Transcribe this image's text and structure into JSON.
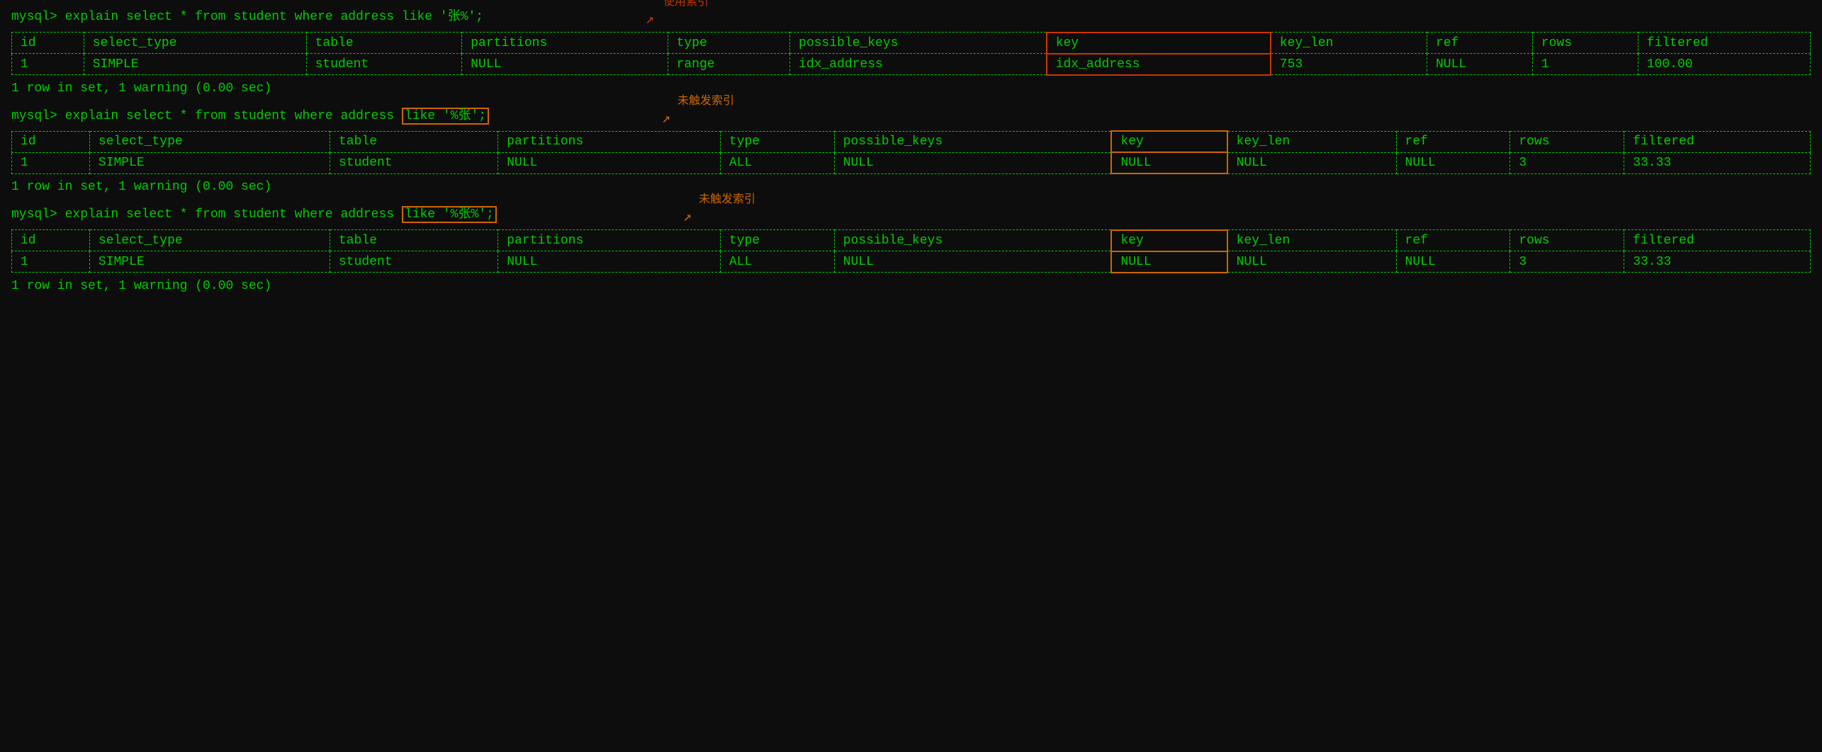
{
  "blocks": [
    {
      "id": "block1",
      "prompt": "mysql> explain select * from student where address like '张%';",
      "highlight": {
        "text": "key",
        "type": "red"
      },
      "annotation": {
        "text": "使用索引",
        "color": "red",
        "arrow": "↙"
      },
      "table": {
        "headers": [
          "id",
          "select_type",
          "table",
          "partitions",
          "type",
          "possible_keys",
          "key",
          "key_len",
          "ref",
          "rows",
          "filtered"
        ],
        "rows": [
          [
            "1",
            "SIMPLE",
            "student",
            "NULL",
            "range",
            "idx_address",
            "idx_address",
            "753",
            "NULL",
            "1",
            "100.00"
          ]
        ],
        "highlight_col": 6,
        "highlight_type": "red"
      },
      "result": "1 row in set, 1 warning (0.00 sec)"
    },
    {
      "id": "block2",
      "prompt_prefix": "mysql> explain select * from student where address ",
      "prompt_highlight": "like '%张';",
      "prompt_highlight_type": "orange",
      "annotation": {
        "text": "未触发索引",
        "color": "orange",
        "arrow": "↙"
      },
      "table": {
        "headers": [
          "id",
          "select_type",
          "table",
          "partitions",
          "type",
          "possible_keys",
          "key",
          "key_len",
          "ref",
          "rows",
          "filtered"
        ],
        "rows": [
          [
            "1",
            "SIMPLE",
            "student",
            "NULL",
            "ALL",
            "NULL",
            "NULL",
            "NULL",
            "NULL",
            "3",
            "33.33"
          ]
        ],
        "highlight_col": 6,
        "highlight_type": "orange"
      },
      "result": "1 row in set, 1 warning (0.00 sec)"
    },
    {
      "id": "block3",
      "prompt_prefix": "mysql> explain select * from student where address ",
      "prompt_highlight": "like '%张%';",
      "prompt_highlight_type": "orange",
      "annotation": {
        "text": "未触发索引",
        "color": "orange",
        "arrow": "↙"
      },
      "table": {
        "headers": [
          "id",
          "select_type",
          "table",
          "partitions",
          "type",
          "possible_keys",
          "key",
          "key_len",
          "ref",
          "rows",
          "filtered"
        ],
        "rows": [
          [
            "1",
            "SIMPLE",
            "student",
            "NULL",
            "ALL",
            "NULL",
            "NULL",
            "NULL",
            "NULL",
            "3",
            "33.33"
          ]
        ],
        "highlight_col": 6,
        "highlight_type": "orange"
      },
      "result": "1 row in set, 1 warning (0.00 sec)"
    }
  ]
}
